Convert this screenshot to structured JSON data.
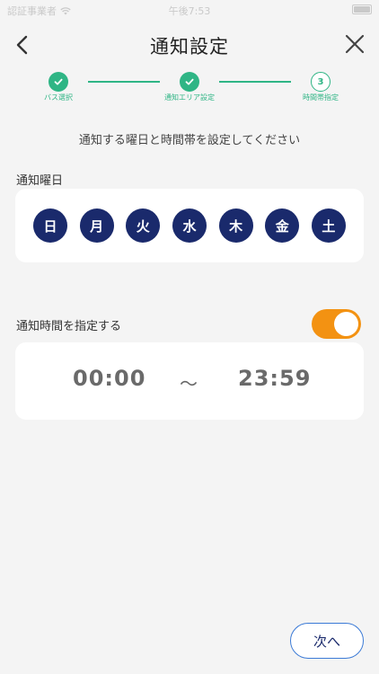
{
  "status_bar": {
    "carrier": "認証事業者",
    "time": "午後7:53"
  },
  "nav": {
    "title": "通知設定"
  },
  "steps": [
    {
      "label": "バス選択",
      "state": "done"
    },
    {
      "label": "通知エリア設定",
      "state": "done"
    },
    {
      "label": "時間帯指定",
      "state": "current",
      "number": "3"
    }
  ],
  "instruction": "通知する曜日と時間帯を設定してください",
  "weekday_section": {
    "label": "通知曜日",
    "days": [
      "日",
      "月",
      "火",
      "水",
      "木",
      "金",
      "土"
    ]
  },
  "time_section": {
    "label": "通知時間を指定する",
    "toggle_on": true,
    "start_time": "00:00",
    "separator": "〜",
    "end_time": "23:59"
  },
  "next_button": "次へ",
  "colors": {
    "accent_green": "#2fb585",
    "day_navy": "#1a2a6c",
    "toggle_orange": "#f39212",
    "button_border": "#3b7ad6"
  }
}
